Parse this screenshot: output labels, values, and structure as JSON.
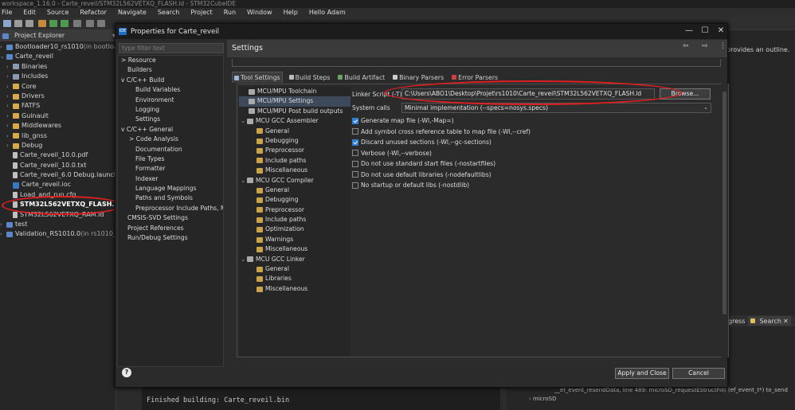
{
  "window": {
    "title": "workspace_1.16.0 - Carte_reveil/STM32L562VETXQ_FLASH.ld - STM32CubeIDE"
  },
  "menu": [
    "File",
    "Edit",
    "Source",
    "Refactor",
    "Navigate",
    "Search",
    "Project",
    "Run",
    "Window",
    "Help",
    "Hello Adam"
  ],
  "explorer": {
    "tab_label": "Project Explorer",
    "items": [
      {
        "label": "Bootloader10_rs1010",
        "suffix": " (in bootloader)"
      },
      {
        "label": "Carte_reveil"
      },
      {
        "label": "Binaries"
      },
      {
        "label": "Includes"
      },
      {
        "label": "Core"
      },
      {
        "label": "Drivers"
      },
      {
        "label": "FATFS"
      },
      {
        "label": "Guinault"
      },
      {
        "label": "Middlewares"
      },
      {
        "label": "lib_gnss"
      },
      {
        "label": "Debug"
      },
      {
        "label": "Carte_reveil_10.0.pdf"
      },
      {
        "label": "Carte_reveil_10.0.txt"
      },
      {
        "label": "Carte_reveil_6.0 Debug.launch"
      },
      {
        "label": "Carte_reveil.ioc"
      },
      {
        "label": "Load_and_run.cfg"
      },
      {
        "label": "STM32L562VETXQ_FLASH.ld"
      },
      {
        "label": "STM32L562VETXQ_RAM.ld"
      },
      {
        "label": "test"
      },
      {
        "label": "Validation_RS1010.0",
        "suffix": " (in rs1010_val)"
      }
    ]
  },
  "right_panel": {
    "outline_message": "provides an outline.",
    "tab_progress": "gress",
    "tab_search": "Search"
  },
  "console": {
    "text": "Finished building: Carte_reveil.bin"
  },
  "bottom_right": {
    "line1": "__ef_event_resendData, line 489: microSD_requestEStructFill( (ef_event_t*) to_send",
    "line2": "microSD"
  },
  "dialog": {
    "title": "Properties for Carte_reveil",
    "filter_placeholder": "type filter text",
    "nav": [
      {
        "label": "Resource",
        "indent": 1,
        "arrow": ">"
      },
      {
        "label": "Builders",
        "indent": 1,
        "arrow": ""
      },
      {
        "label": "C/C++ Build",
        "indent": 1,
        "arrow": "v"
      },
      {
        "label": "Build Variables",
        "indent": 2,
        "arrow": ""
      },
      {
        "label": "Environment",
        "indent": 2,
        "arrow": ""
      },
      {
        "label": "Logging",
        "indent": 2,
        "arrow": ""
      },
      {
        "label": "Settings",
        "indent": 2,
        "arrow": ""
      },
      {
        "label": "C/C++ General",
        "indent": 1,
        "arrow": "v"
      },
      {
        "label": "Code Analysis",
        "indent": 2,
        "arrow": ">"
      },
      {
        "label": "Documentation",
        "indent": 2,
        "arrow": ""
      },
      {
        "label": "File Types",
        "indent": 2,
        "arrow": ""
      },
      {
        "label": "Formatter",
        "indent": 2,
        "arrow": ""
      },
      {
        "label": "Indexer",
        "indent": 2,
        "arrow": ""
      },
      {
        "label": "Language Mappings",
        "indent": 2,
        "arrow": ""
      },
      {
        "label": "Paths and Symbols",
        "indent": 2,
        "arrow": ""
      },
      {
        "label": "Preprocessor Include Paths, Ma",
        "indent": 2,
        "arrow": ""
      },
      {
        "label": "CMSIS-SVD Settings",
        "indent": 1,
        "arrow": ""
      },
      {
        "label": "Project References",
        "indent": 1,
        "arrow": ""
      },
      {
        "label": "Run/Debug Settings",
        "indent": 1,
        "arrow": ""
      }
    ],
    "header": "Settings",
    "tabs": [
      "Tool Settings",
      "Build Steps",
      "Build Artifact",
      "Binary Parsers",
      "Error Parsers"
    ],
    "tool_tree": [
      {
        "label": "MCU/MPU Toolchain",
        "indent": 1
      },
      {
        "label": "MCU/MPU Settings",
        "indent": 1
      },
      {
        "label": "MCU/MPU Post build outputs",
        "indent": 1
      },
      {
        "label": "MCU GCC Assembler",
        "indent": 0
      },
      {
        "label": "General",
        "indent": 2
      },
      {
        "label": "Debugging",
        "indent": 2
      },
      {
        "label": "Preprocessor",
        "indent": 2
      },
      {
        "label": "Include paths",
        "indent": 2
      },
      {
        "label": "Miscellaneous",
        "indent": 2
      },
      {
        "label": "MCU GCC Compiler",
        "indent": 0
      },
      {
        "label": "General",
        "indent": 2
      },
      {
        "label": "Debugging",
        "indent": 2
      },
      {
        "label": "Preprocessor",
        "indent": 2
      },
      {
        "label": "Include paths",
        "indent": 2
      },
      {
        "label": "Optimization",
        "indent": 2
      },
      {
        "label": "Warnings",
        "indent": 2
      },
      {
        "label": "Miscellaneous",
        "indent": 2
      },
      {
        "label": "MCU GCC Linker",
        "indent": 0
      },
      {
        "label": "General",
        "indent": 2
      },
      {
        "label": "Libraries",
        "indent": 2
      },
      {
        "label": "Miscellaneous",
        "indent": 2
      }
    ],
    "linker_script_label": "Linker Script (-T)",
    "linker_script_value": "C:\\Users\\ABO1\\Desktop\\Projet\\rs1010\\Carte_reveil\\STM32L562VETXQ_FLASH.ld",
    "browse_label": "Browse...",
    "system_calls_label": "System calls",
    "system_calls_value": "Minimal implementation (--specs=nosys.specs)",
    "options": [
      {
        "label": "Generate map file (-Wl,-Map=)",
        "checked": true
      },
      {
        "label": "Add symbol cross reference table to map file (-Wl,--cref)",
        "checked": false
      },
      {
        "label": "Discard unused sections (-Wl,--gc-sections)",
        "checked": true
      },
      {
        "label": "Verbose (-Wl,--verbose)",
        "checked": false
      },
      {
        "label": "Do not use standard start files (-nostartfiles)",
        "checked": false
      },
      {
        "label": "Do not use default libraries (-nodefaultlibs)",
        "checked": false
      },
      {
        "label": "No startup or default libs (-nostdlib)",
        "checked": false
      }
    ],
    "apply_close_label": "Apply and Close",
    "cancel_label": "Cancel",
    "help_glyph": "?"
  }
}
